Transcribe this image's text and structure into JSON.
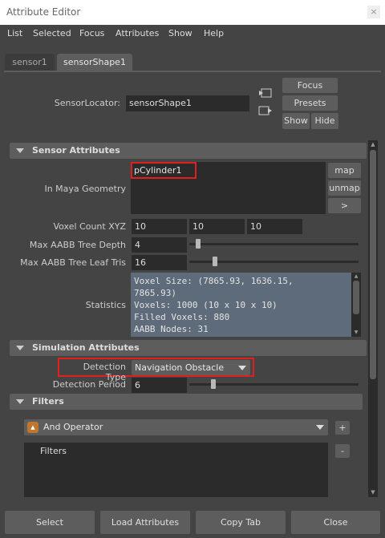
{
  "window": {
    "title": "Attribute Editor",
    "close_glyph": "×"
  },
  "menu": [
    "List",
    "Selected",
    "Focus",
    "Attributes",
    "Show",
    "Help"
  ],
  "tabs": [
    "sensor1",
    "sensorShape1"
  ],
  "locator": {
    "label": "SensorLocator:",
    "value": "sensorShape1",
    "focus": "Focus",
    "presets": "Presets",
    "show": "Show",
    "hide": "Hide"
  },
  "sensor_attributes": {
    "header": "Sensor Attributes",
    "geometry_label": "In Maya Geometry",
    "geometry_value": "pCylinder1",
    "map": "map",
    "unmap": "unmap",
    "more": ">",
    "voxel_label": "Voxel Count XYZ",
    "voxel": [
      "10",
      "10",
      "10"
    ],
    "depth_label": "Max AABB Tree Depth",
    "depth_value": "4",
    "depth_slider_fraction": 0.04,
    "leaf_label": "Max AABB Tree Leaf Tris",
    "leaf_value": "16",
    "leaf_slider_fraction": 0.14,
    "stats_label": "Statistics",
    "stats_lines": [
      "Voxel Size: (7865.93, 1636.15,",
      "7865.93)",
      "Voxels: 1000 (10 x 10 x 10)",
      "Filled Voxels: 880",
      "AABB Nodes: 31"
    ]
  },
  "simulation_attributes": {
    "header": "Simulation Attributes",
    "detection_label": "Detection Type",
    "detection_value": "Navigation Obstacle",
    "period_label": "Detection Period",
    "period_value": "6",
    "period_slider_fraction": 0.13
  },
  "filters": {
    "header": "Filters",
    "operator": "And Operator",
    "plus": "+",
    "minus": "-",
    "list_label": "Filters"
  },
  "bottom": [
    "Select",
    "Load Attributes",
    "Copy Tab",
    "Close"
  ],
  "colors": {
    "highlight": "#e02020",
    "stats_bg": "#5e6b7a",
    "panel": "#444444"
  }
}
